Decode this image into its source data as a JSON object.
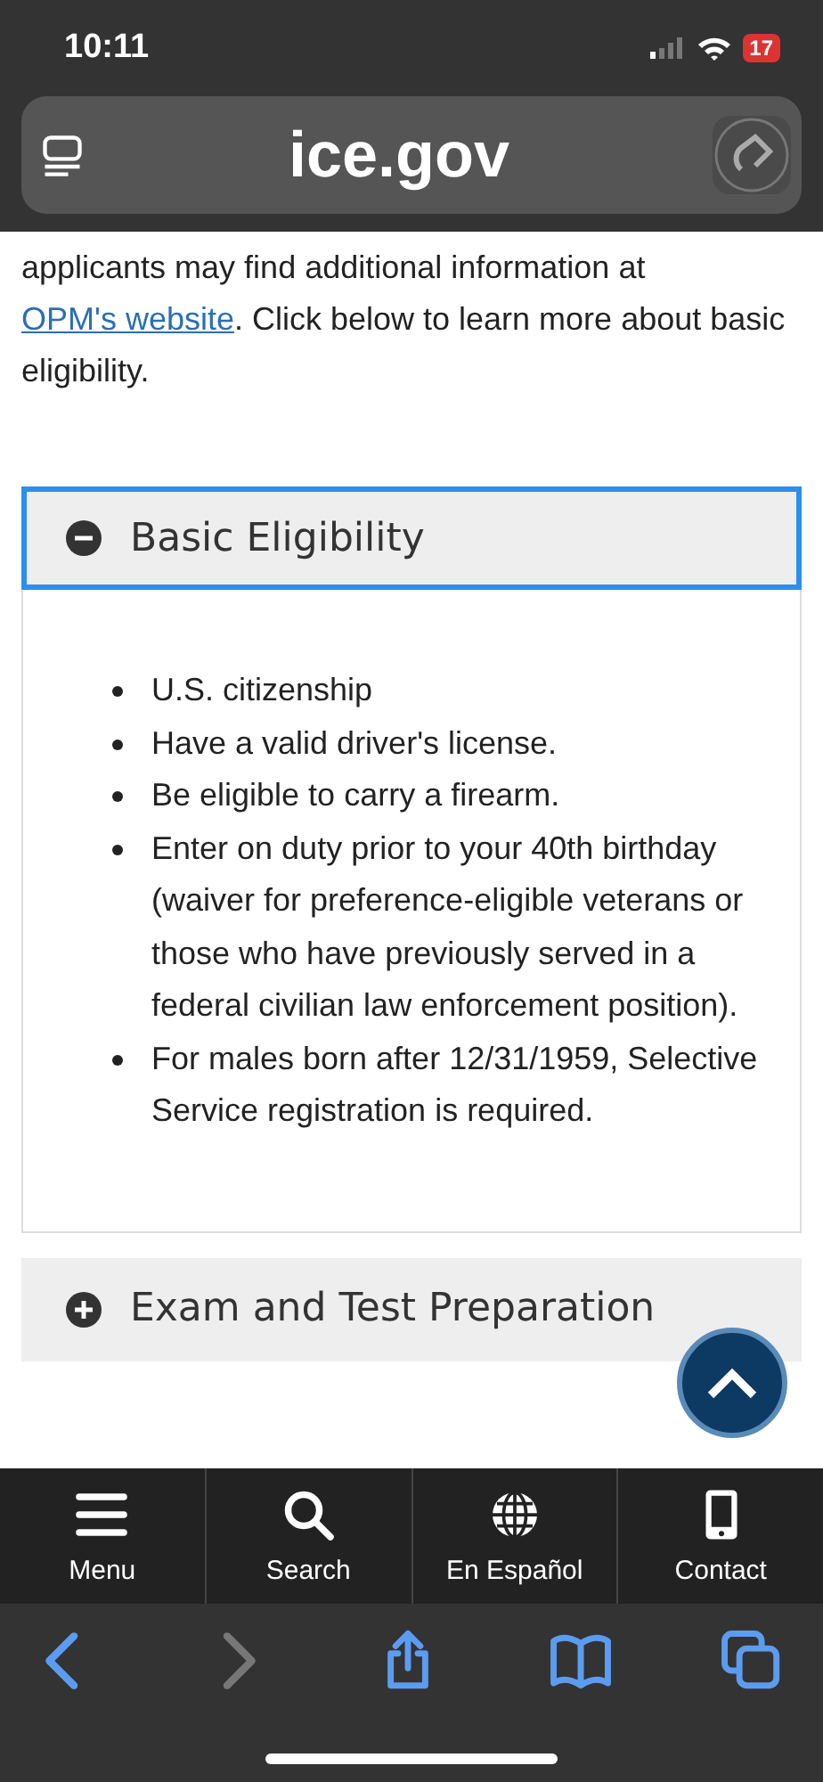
{
  "status_bar": {
    "time": "10:11",
    "battery": "17"
  },
  "address_bar": {
    "domain": "ice.gov"
  },
  "intro": {
    "text": "applicants may find additional information at ",
    "link": "OPM's website",
    "after": ". Click below to learn more about basic eligibility."
  },
  "accordions": [
    {
      "title": "Basic Eligibility",
      "expanded": true,
      "focused": true,
      "items": [
        "U.S. citizenship",
        "Have a valid driver's license.",
        "Be eligible to carry a firearm.",
        "Enter on duty prior to your 40th birthday (waiver for preference-eligible veterans or those who have previously served in a federal civilian law enforcement position).",
        "For males born after 12/31/1959, Selective Service registration is required."
      ]
    },
    {
      "title": "Exam and Test Preparation",
      "expanded": false,
      "focused": false
    }
  ],
  "site_nav": [
    {
      "label": "Menu"
    },
    {
      "label": "Search"
    },
    {
      "label": "En Español"
    },
    {
      "label": "Contact"
    }
  ],
  "browser_toolbar": [
    {
      "disabled": false
    },
    {
      "disabled": true
    },
    {
      "disabled": false
    },
    {
      "disabled": false
    },
    {
      "disabled": false
    }
  ]
}
